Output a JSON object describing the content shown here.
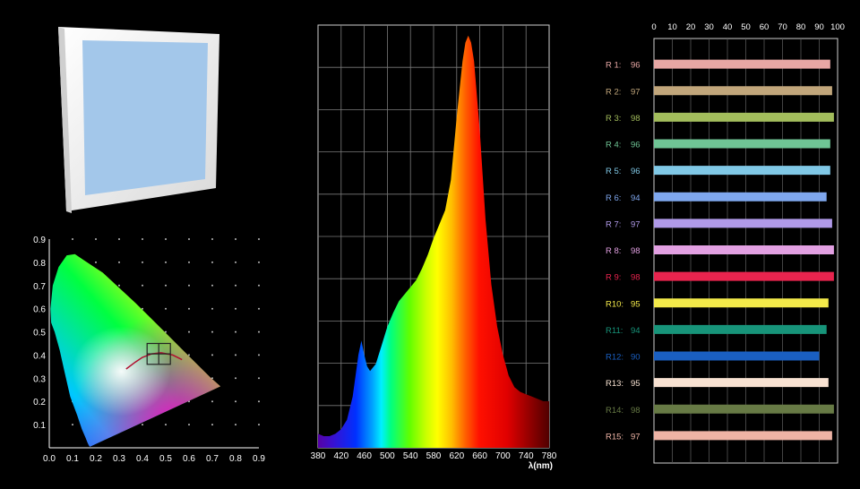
{
  "fixture_panel": {
    "icon": "led-panel-light-icon",
    "frame_color": "#f2f2f2",
    "lens_color": "#a3c7ea"
  },
  "cie": {
    "x_ticks": [
      "0.0",
      "0.1",
      "0.2",
      "0.3",
      "0.4",
      "0.5",
      "0.6",
      "0.7",
      "0.8",
      "0.9"
    ],
    "y_ticks": [
      "0.1",
      "0.2",
      "0.3",
      "0.4",
      "0.5",
      "0.6",
      "0.7",
      "0.8",
      "0.9"
    ],
    "grid": "dots",
    "locus": [
      [
        0.175,
        0.005
      ],
      [
        0.174,
        0.005
      ],
      [
        0.17,
        0.01
      ],
      [
        0.165,
        0.02
      ],
      [
        0.155,
        0.045
      ],
      [
        0.14,
        0.08
      ],
      [
        0.12,
        0.14
      ],
      [
        0.09,
        0.22
      ],
      [
        0.065,
        0.33
      ],
      [
        0.045,
        0.42
      ],
      [
        0.023,
        0.5
      ],
      [
        0.008,
        0.54
      ],
      [
        0.005,
        0.6
      ],
      [
        0.015,
        0.7
      ],
      [
        0.04,
        0.78
      ],
      [
        0.075,
        0.83
      ],
      [
        0.11,
        0.835
      ],
      [
        0.155,
        0.805
      ],
      [
        0.23,
        0.755
      ],
      [
        0.3,
        0.69
      ],
      [
        0.37,
        0.625
      ],
      [
        0.44,
        0.555
      ],
      [
        0.51,
        0.485
      ],
      [
        0.58,
        0.415
      ],
      [
        0.64,
        0.355
      ],
      [
        0.69,
        0.305
      ],
      [
        0.735,
        0.265
      ]
    ],
    "planckian": [
      [
        0.33,
        0.34
      ],
      [
        0.37,
        0.37
      ],
      [
        0.4,
        0.39
      ],
      [
        0.44,
        0.405
      ],
      [
        0.48,
        0.41
      ],
      [
        0.53,
        0.4
      ],
      [
        0.57,
        0.38
      ]
    ],
    "target_box": {
      "x": [
        0.42,
        0.52
      ],
      "y": [
        0.36,
        0.45
      ]
    }
  },
  "spectrum": {
    "x_ticks": [
      "380",
      "420",
      "460",
      "500",
      "540",
      "580",
      "620",
      "660",
      "700",
      "740",
      "780"
    ],
    "xlabel": "λ(nm)",
    "wavelengths": [
      380,
      390,
      400,
      410,
      420,
      430,
      440,
      450,
      455,
      460,
      465,
      470,
      480,
      490,
      500,
      510,
      520,
      530,
      540,
      550,
      560,
      570,
      580,
      590,
      600,
      610,
      620,
      630,
      635,
      640,
      645,
      650,
      660,
      670,
      680,
      690,
      700,
      710,
      720,
      730,
      740,
      750,
      760,
      770,
      780
    ],
    "relative_power": [
      0.06,
      0.05,
      0.05,
      0.06,
      0.08,
      0.12,
      0.22,
      0.4,
      0.46,
      0.4,
      0.35,
      0.33,
      0.36,
      0.44,
      0.52,
      0.58,
      0.63,
      0.66,
      0.69,
      0.72,
      0.77,
      0.83,
      0.9,
      0.96,
      1.02,
      1.15,
      1.42,
      1.66,
      1.74,
      1.77,
      1.74,
      1.66,
      1.36,
      0.98,
      0.7,
      0.52,
      0.4,
      0.31,
      0.26,
      0.24,
      0.23,
      0.22,
      0.21,
      0.2,
      0.2
    ],
    "peak_max": 1.8
  },
  "cri": {
    "axis_ticks": [
      "0",
      "10",
      "20",
      "30",
      "40",
      "50",
      "60",
      "70",
      "80",
      "90",
      "100"
    ],
    "items": [
      {
        "label": "R 1:",
        "value": 96,
        "color": "#e7a7a4"
      },
      {
        "label": "R 2:",
        "value": 97,
        "color": "#c1a67b"
      },
      {
        "label": "R 3:",
        "value": 98,
        "color": "#a3bd5c"
      },
      {
        "label": "R 4:",
        "value": 96,
        "color": "#6fc595"
      },
      {
        "label": "R 5:",
        "value": 96,
        "color": "#80c8e6"
      },
      {
        "label": "R 6:",
        "value": 94,
        "color": "#7fa7ee"
      },
      {
        "label": "R 7:",
        "value": 97,
        "color": "#b09ae9"
      },
      {
        "label": "R 8:",
        "value": 98,
        "color": "#e2a0e2"
      },
      {
        "label": "R 9:",
        "value": 98,
        "color": "#e8244e"
      },
      {
        "label": "R10:",
        "value": 95,
        "color": "#f4ea4a"
      },
      {
        "label": "R11:",
        "value": 94,
        "color": "#17947a"
      },
      {
        "label": "R12:",
        "value": 90,
        "color": "#1a5fc1"
      },
      {
        "label": "R13:",
        "value": 95,
        "color": "#f8e2d2"
      },
      {
        "label": "R14:",
        "value": 98,
        "color": "#677a45"
      },
      {
        "label": "R15:",
        "value": 97,
        "color": "#eeb3a5"
      }
    ]
  },
  "chart_data": [
    {
      "type": "scatter",
      "xlim": [
        0,
        0.9
      ],
      "ylim": [
        0,
        0.9
      ],
      "x_ticks": [
        "0.0",
        "0.1",
        "0.2",
        "0.3",
        "0.4",
        "0.5",
        "0.6",
        "0.7",
        "0.8",
        "0.9"
      ],
      "y_ticks": [
        "0.1",
        "0.2",
        "0.3",
        "0.4",
        "0.5",
        "0.6",
        "0.7",
        "0.8",
        "0.9"
      ],
      "grid": "dots"
    },
    {
      "type": "area",
      "x_ticks": [
        "380",
        "420",
        "460",
        "500",
        "540",
        "580",
        "620",
        "660",
        "700",
        "740",
        "780"
      ],
      "xlabel": "λ(nm)",
      "xlim": [
        380,
        780
      ],
      "grid": true,
      "series": [
        {
          "x_ref": "spectrum.wavelengths",
          "y_ref": "spectrum.relative_power"
        }
      ]
    },
    {
      "type": "bar",
      "orientation": "horizontal",
      "categories": [
        "R 1:",
        "R 2:",
        "R 3:",
        "R 4:",
        "R 5:",
        "R 6:",
        "R 7:",
        "R 8:",
        "R 9:",
        "R10:",
        "R11:",
        "R12:",
        "R13:",
        "R14:",
        "R15:"
      ],
      "values": [
        96,
        97,
        98,
        96,
        96,
        94,
        97,
        98,
        98,
        95,
        94,
        90,
        95,
        98,
        97
      ],
      "xlim": [
        0,
        100
      ],
      "grid": true
    }
  ]
}
